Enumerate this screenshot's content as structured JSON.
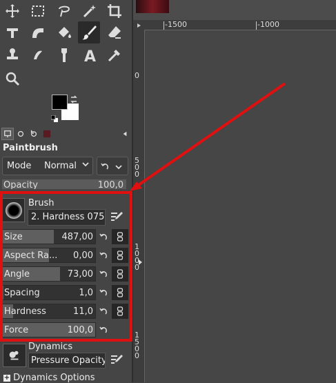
{
  "tool_options": {
    "title": "Paintbrush",
    "mode_label": "Mode",
    "mode_value": "Normal",
    "opacity_label": "Opacity",
    "opacity_value": "100,0",
    "brush_label": "Brush",
    "brush_name": "2. Hardness 075",
    "sliders": [
      {
        "label": "Size",
        "value": "487,00",
        "fraction": 0.55
      },
      {
        "label": "Aspect Ra...",
        "value": "0,00",
        "fraction": 0.5
      },
      {
        "label": "Angle",
        "value": "73,00",
        "fraction": 0.62
      },
      {
        "label": "Spacing",
        "value": "1,0",
        "fraction": 0.01
      },
      {
        "label": "Hardness",
        "value": "11,0",
        "fraction": 0.11
      },
      {
        "label": "Force",
        "value": "100,0",
        "fraction": 1.0
      }
    ],
    "dynamics_label": "Dynamics",
    "dynamics_name": "Pressure Opacity",
    "dynamics_options_label": "Dynamics Options"
  },
  "rulers": {
    "h_ticks": [
      "-1500",
      "-1000"
    ],
    "v_ticks": [
      "0",
      "500",
      "1000",
      "1500"
    ]
  },
  "colors": {
    "annotation": "#e01010"
  }
}
